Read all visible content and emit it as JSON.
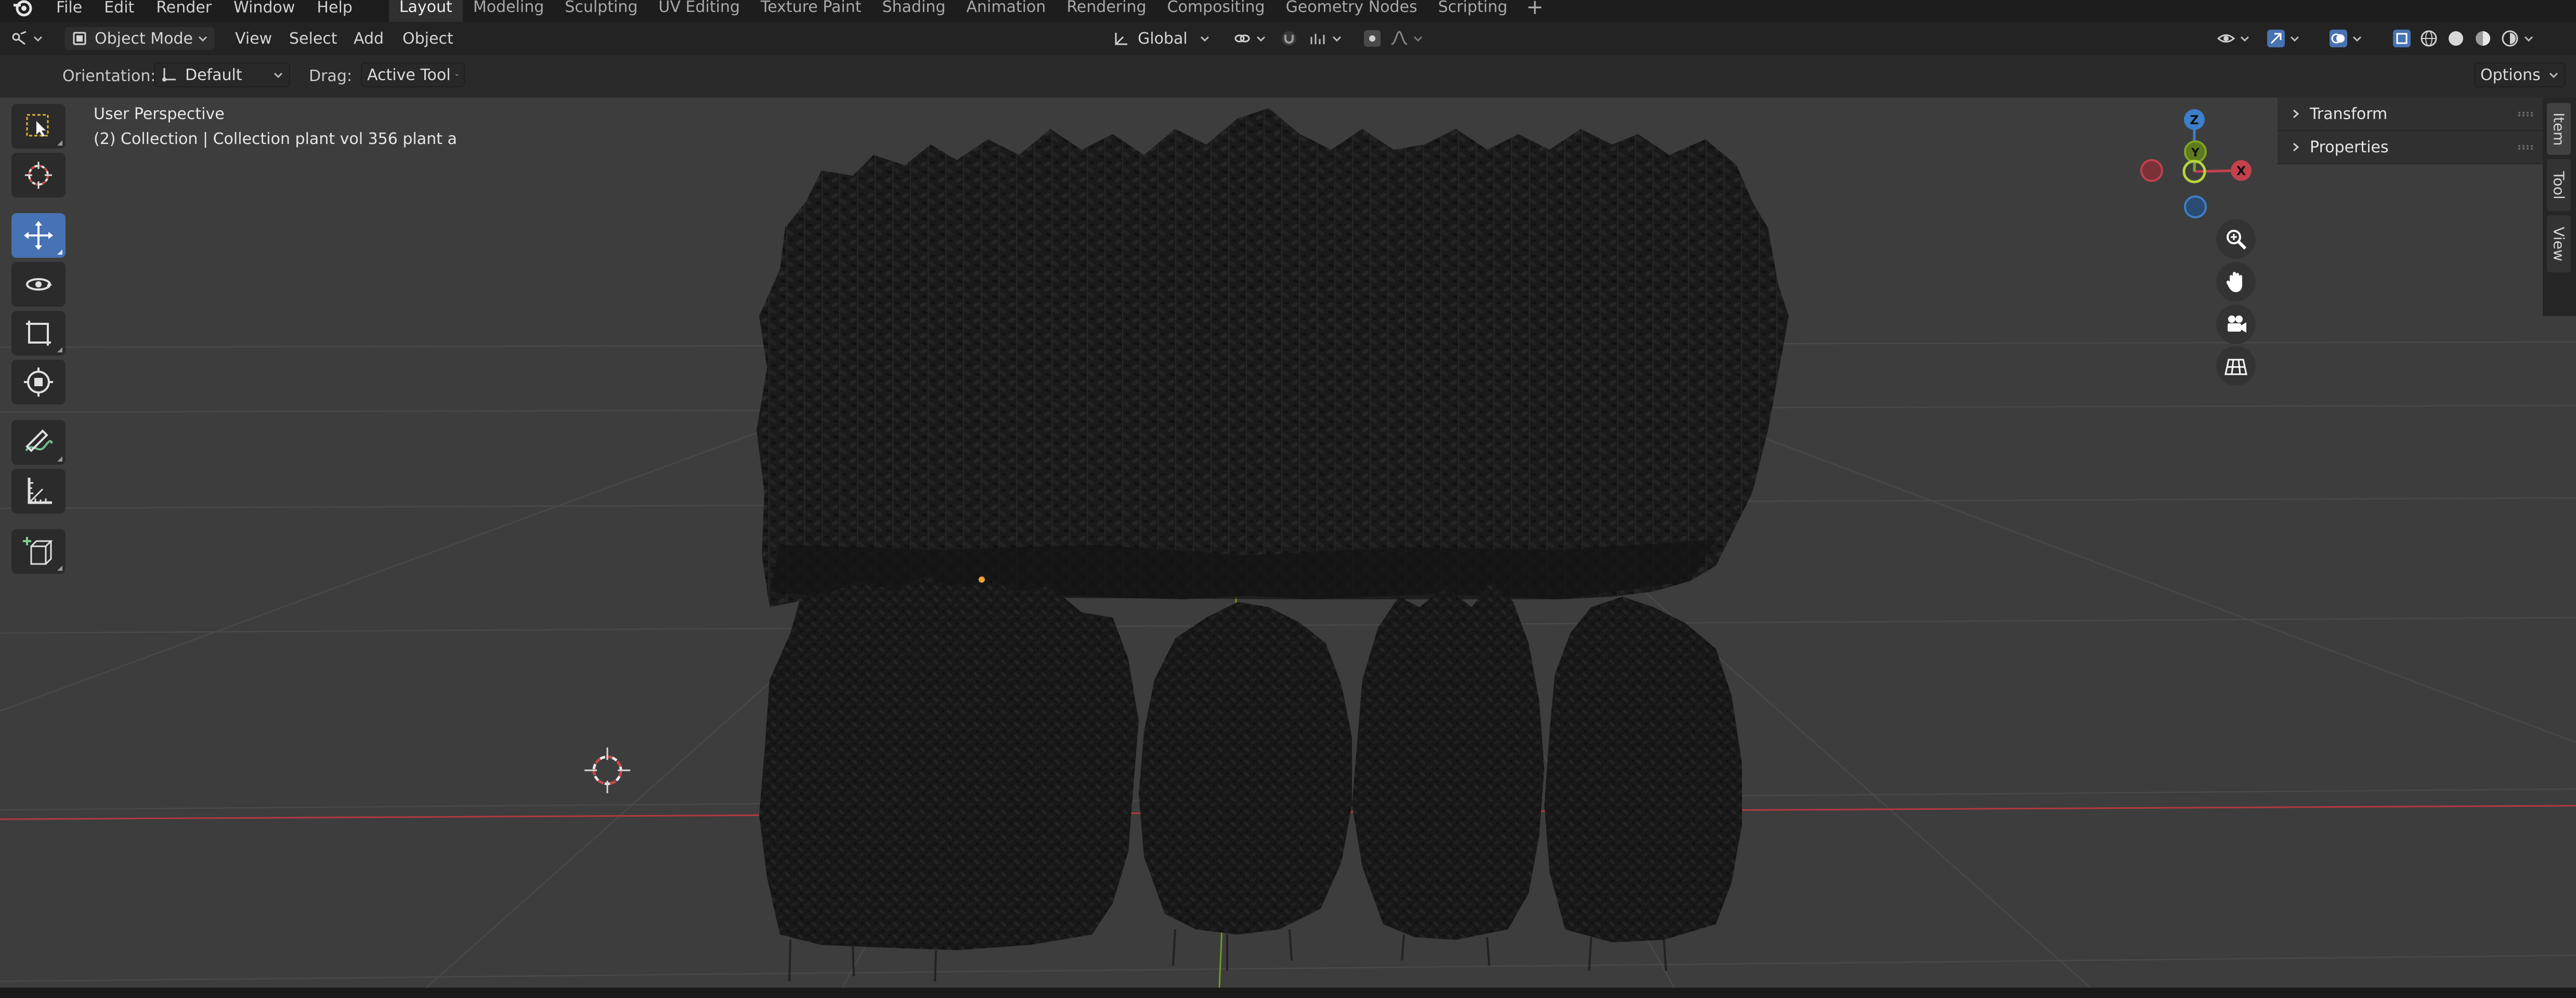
{
  "menubar": {
    "items": [
      "File",
      "Edit",
      "Render",
      "Window",
      "Help"
    ],
    "tabs": [
      "Layout",
      "Modeling",
      "Sculpting",
      "UV Editing",
      "Texture Paint",
      "Shading",
      "Animation",
      "Rendering",
      "Compositing",
      "Geometry Nodes",
      "Scripting"
    ],
    "active_tab": "Layout",
    "add_tab": "+"
  },
  "header": {
    "mode": "Object Mode",
    "menus": [
      "View",
      "Select",
      "Add",
      "Object"
    ],
    "transform_orientation": "Global"
  },
  "tool_settings": {
    "orientation_label": "Orientation:",
    "orientation_value": "Default",
    "drag_label": "Drag:",
    "drag_value": "Active Tool",
    "options_label": "Options"
  },
  "viewport": {
    "view_name": "User Perspective",
    "context_line": "(2) Collection | Collection plant vol 356 plant a"
  },
  "gizmo": {
    "z": "Z",
    "x": "X",
    "y": "Y"
  },
  "sidebar": {
    "panels": [
      "Transform",
      "Properties"
    ],
    "tabs": [
      "Item",
      "Tool",
      "View"
    ]
  },
  "colors": {
    "accent": "#4772b3",
    "x_axis": "#c3404d",
    "y_axis": "#7ea426",
    "z_axis": "#3c7fcc",
    "viewport_bg": "#3d3d3d"
  },
  "icons": {
    "toolbox": [
      "select-box-icon",
      "cursor-icon",
      "move-icon",
      "rotate-icon",
      "scale-icon",
      "transform-icon",
      "annotate-icon",
      "measure-icon",
      "add-cube-icon"
    ],
    "navigation": [
      "zoom-icon",
      "hand-pan-icon",
      "camera-icon",
      "grid-ortho-icon"
    ]
  }
}
